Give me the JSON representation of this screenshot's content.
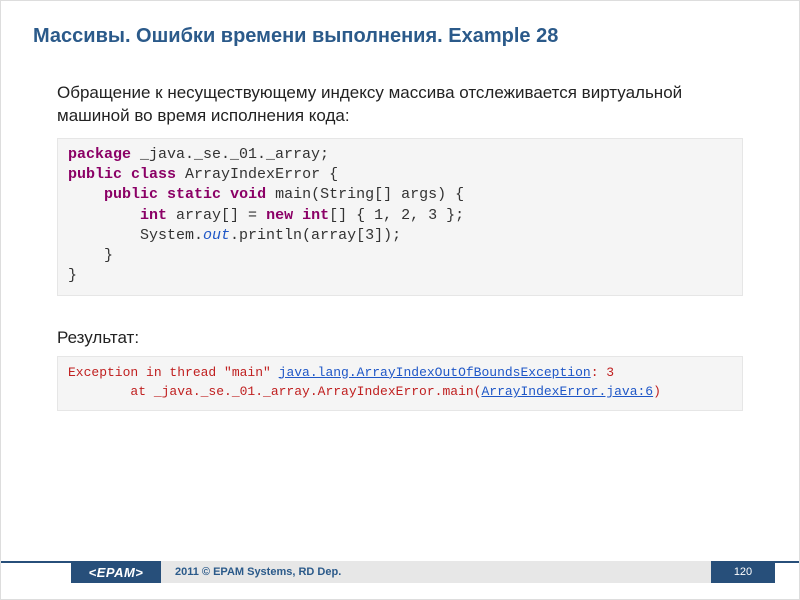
{
  "title": "Массивы. Ошибки времени выполнения. Example 28",
  "description": "Обращение к несуществующему индексу массива отслеживается виртуальной машиной во время исполнения кода:",
  "code": {
    "kw_package": "package",
    "pkg_name": " _java._se._01._array;",
    "kw_public1": "public",
    "kw_class": "class",
    "class_name": " ArrayIndexError {",
    "indent1": "    ",
    "kw_public2": "public",
    "kw_static": "static",
    "kw_void": "void",
    "main_sig": " main(String[] args) {",
    "indent2": "        ",
    "kw_int": "int",
    "arr_decl": " array[] = ",
    "kw_new": "new",
    "kw_int2": "int",
    "arr_init": "[] { 1, 2, 3 };",
    "sys": "System.",
    "out": "out",
    "println": ".println(array[3]);",
    "close1": "    }",
    "close2": "}"
  },
  "result_label": "Результат:",
  "output": {
    "line1_a": "Exception in thread \"main\" ",
    "line1_b": "java.lang.ArrayIndexOutOfBoundsException",
    "line1_c": ": 3",
    "line2_a": "        at _java._se._01._array.ArrayIndexError.main(",
    "line2_b": "ArrayIndexError.java:6",
    "line2_c": ")"
  },
  "footer": {
    "logo": "<EPAM>",
    "copyright": "2011 © EPAM Systems, RD Dep.",
    "page": "120"
  }
}
